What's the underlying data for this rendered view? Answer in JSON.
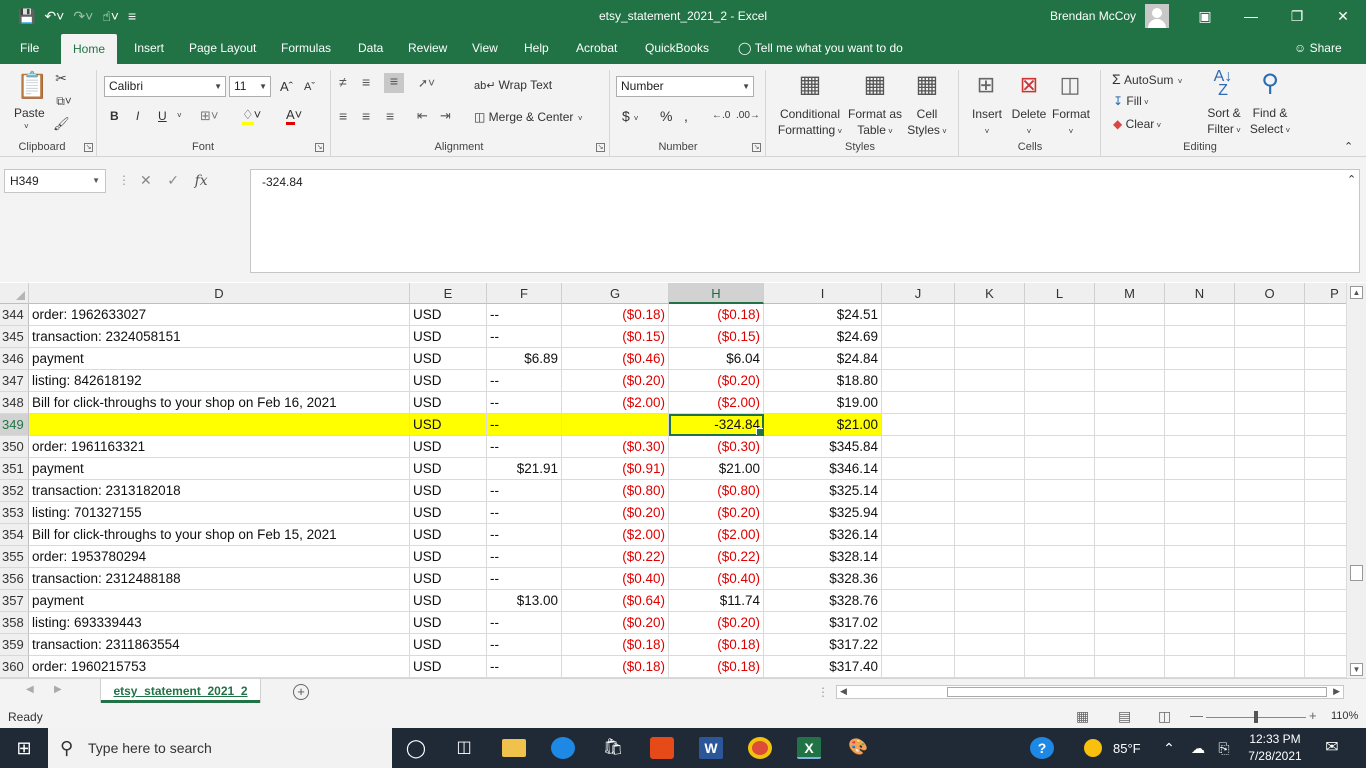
{
  "app": {
    "title": "etsy_statement_2021_2  -  Excel",
    "user_name": "Brendan McCoy"
  },
  "ribbon_tabs": [
    "File",
    "Home",
    "Insert",
    "Page Layout",
    "Formulas",
    "Data",
    "Review",
    "View",
    "Help",
    "Acrobat",
    "QuickBooks"
  ],
  "tell_me": "Tell me what you want to do",
  "share_label": "Share",
  "ribbon": {
    "paste_label": "Paste",
    "font_name": "Calibri",
    "font_size": "11",
    "wrap_text": "Wrap Text",
    "merge_center": "Merge & Center",
    "number_format": "Number",
    "conditional_formatting": [
      "Conditional",
      "Formatting"
    ],
    "format_as_table": [
      "Format as",
      "Table"
    ],
    "cell_styles": [
      "Cell",
      "Styles"
    ],
    "insert": "Insert",
    "delete": "Delete",
    "format": "Format",
    "autosum": "AutoSum",
    "fill": "Fill",
    "clear": "Clear",
    "sort_filter": [
      "Sort &",
      "Filter"
    ],
    "find_select": [
      "Find &",
      "Select"
    ],
    "groups": [
      "Clipboard",
      "Font",
      "Alignment",
      "Number",
      "Styles",
      "Cells",
      "Editing"
    ]
  },
  "formula_bar": {
    "name_box": "H349",
    "formula": "-324.84"
  },
  "columns": [
    "D",
    "E",
    "F",
    "G",
    "H",
    "I",
    "J",
    "K",
    "L",
    "M",
    "N",
    "O",
    "P"
  ],
  "rows": [
    {
      "num": "344",
      "d": "order: 1962633027",
      "e": "USD",
      "f": "--",
      "g": "($0.18)",
      "h": "($0.18)",
      "i": "$24.51"
    },
    {
      "num": "345",
      "d": "transaction: 2324058151",
      "e": "USD",
      "f": "--",
      "g": "($0.15)",
      "h": "($0.15)",
      "i": "$24.69"
    },
    {
      "num": "346",
      "d": "payment",
      "e": "USD",
      "f": "$6.89",
      "g": "($0.46)",
      "h": "$6.04",
      "i": "$24.84"
    },
    {
      "num": "347",
      "d": "listing: 842618192",
      "e": "USD",
      "f": "--",
      "g": "($0.20)",
      "h": "($0.20)",
      "i": "$18.80"
    },
    {
      "num": "348",
      "d": "Bill for click-throughs to your shop on Feb 16, 2021",
      "e": "USD",
      "f": "--",
      "g": "($2.00)",
      "h": "($2.00)",
      "i": "$19.00"
    },
    {
      "num": "349",
      "d": "",
      "e": "USD",
      "f": "--",
      "g": "",
      "h": "-324.84",
      "i": "$21.00"
    },
    {
      "num": "350",
      "d": "order: 1961163321",
      "e": "USD",
      "f": "--",
      "g": "($0.30)",
      "h": "($0.30)",
      "i": "$345.84"
    },
    {
      "num": "351",
      "d": "payment",
      "e": "USD",
      "f": "$21.91",
      "g": "($0.91)",
      "h": "$21.00",
      "i": "$346.14"
    },
    {
      "num": "352",
      "d": "transaction: 2313182018",
      "e": "USD",
      "f": "--",
      "g": "($0.80)",
      "h": "($0.80)",
      "i": "$325.14"
    },
    {
      "num": "353",
      "d": "listing: 701327155",
      "e": "USD",
      "f": "--",
      "g": "($0.20)",
      "h": "($0.20)",
      "i": "$325.94"
    },
    {
      "num": "354",
      "d": "Bill for click-throughs to your shop on Feb 15, 2021",
      "e": "USD",
      "f": "--",
      "g": "($2.00)",
      "h": "($2.00)",
      "i": "$326.14"
    },
    {
      "num": "355",
      "d": "order: 1953780294",
      "e": "USD",
      "f": "--",
      "g": "($0.22)",
      "h": "($0.22)",
      "i": "$328.14"
    },
    {
      "num": "356",
      "d": "transaction: 2312488188",
      "e": "USD",
      "f": "--",
      "g": "($0.40)",
      "h": "($0.40)",
      "i": "$328.36"
    },
    {
      "num": "357",
      "d": "payment",
      "e": "USD",
      "f": "$13.00",
      "g": "($0.64)",
      "h": "$11.74",
      "i": "$328.76"
    },
    {
      "num": "358",
      "d": "listing: 693339443",
      "e": "USD",
      "f": "--",
      "g": "($0.20)",
      "h": "($0.20)",
      "i": "$317.02"
    },
    {
      "num": "359",
      "d": "transaction: 2311863554",
      "e": "USD",
      "f": "--",
      "g": "($0.18)",
      "h": "($0.18)",
      "i": "$317.22"
    },
    {
      "num": "360",
      "d": "order: 1960215753",
      "e": "USD",
      "f": "--",
      "g": "($0.18)",
      "h": "($0.18)",
      "i": "$317.40"
    }
  ],
  "sheet_tab": "etsy_statement_2021_2",
  "status": {
    "ready": "Ready",
    "zoom": "110%"
  },
  "taskbar": {
    "search_placeholder": "Type here to search",
    "temperature": "85°F",
    "time": "12:33 PM",
    "date": "7/28/2021"
  },
  "colors": {
    "excel_green": "#217346",
    "highlight": "#ffff00",
    "negative": "#e00000"
  }
}
